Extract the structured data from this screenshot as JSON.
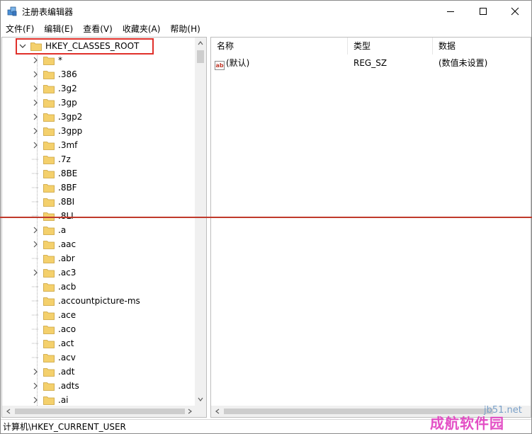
{
  "window": {
    "title": "注册表编辑器"
  },
  "menu": [
    "文件(F)",
    "编辑(E)",
    "查看(V)",
    "收藏夹(A)",
    "帮助(H)"
  ],
  "tree": {
    "root": "HKEY_CLASSES_ROOT",
    "items": [
      {
        "label": "*",
        "expandable": true
      },
      {
        "label": ".386",
        "expandable": true
      },
      {
        "label": ".3g2",
        "expandable": true
      },
      {
        "label": ".3gp",
        "expandable": true
      },
      {
        "label": ".3gp2",
        "expandable": true
      },
      {
        "label": ".3gpp",
        "expandable": true
      },
      {
        "label": ".3mf",
        "expandable": true
      },
      {
        "label": ".7z",
        "expandable": false
      },
      {
        "label": ".8BE",
        "expandable": false
      },
      {
        "label": ".8BF",
        "expandable": false
      },
      {
        "label": ".8BI",
        "expandable": false
      },
      {
        "label": ".8LI",
        "expandable": false
      },
      {
        "label": ".a",
        "expandable": true
      },
      {
        "label": ".aac",
        "expandable": true
      },
      {
        "label": ".abr",
        "expandable": false
      },
      {
        "label": ".ac3",
        "expandable": true
      },
      {
        "label": ".acb",
        "expandable": false
      },
      {
        "label": ".accountpicture-ms",
        "expandable": false
      },
      {
        "label": ".ace",
        "expandable": false
      },
      {
        "label": ".aco",
        "expandable": false
      },
      {
        "label": ".act",
        "expandable": false
      },
      {
        "label": ".acv",
        "expandable": false
      },
      {
        "label": ".adt",
        "expandable": true
      },
      {
        "label": ".adts",
        "expandable": true
      },
      {
        "label": ".ai",
        "expandable": true
      }
    ]
  },
  "list": {
    "columns": [
      "名称",
      "类型",
      "数据"
    ],
    "rows": [
      {
        "name": "(默认)",
        "type": "REG_SZ",
        "data": "(数值未设置)",
        "icon": "ab-string-icon"
      }
    ]
  },
  "status": "计算机\\HKEY_CURRENT_USER",
  "watermark": {
    "url": "jb51.net",
    "text": "成航软件园"
  },
  "colors": {
    "highlight_border": "#e0302a",
    "folder": "#f4d06c",
    "red_line": "#c0392b"
  }
}
